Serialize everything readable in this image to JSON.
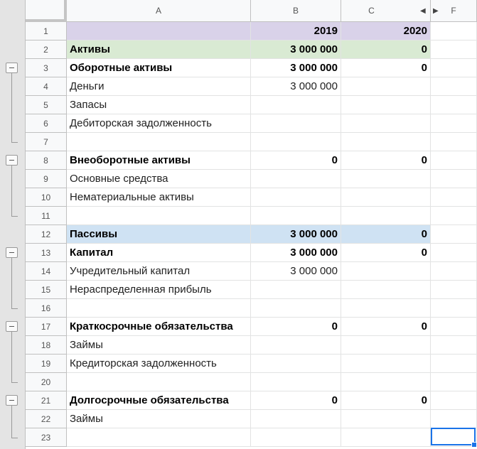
{
  "columns": {
    "A": "A",
    "B": "B",
    "C": "C",
    "F": "F"
  },
  "col_nav_icons": {
    "left": "triangle-left-icon",
    "right": "triangle-right-icon"
  },
  "colors": {
    "header_purple": "#d9d2e9",
    "assets_green": "#d9ead3",
    "liabilities_blue": "#cfe2f3",
    "selection_blue": "#1a73e8"
  },
  "rows": [
    {
      "n": "1",
      "a": "",
      "b": "2019",
      "c": "2020",
      "bold": true,
      "bg": "purple"
    },
    {
      "n": "2",
      "a": "Активы",
      "b": "3 000 000",
      "c": "0",
      "bold": true,
      "bg": "green"
    },
    {
      "n": "3",
      "a": "Оборотные активы",
      "b": "3 000 000",
      "c": "0",
      "bold": true,
      "bg": ""
    },
    {
      "n": "4",
      "a": "Деньги",
      "b": "3 000 000",
      "c": "",
      "bold": false,
      "bg": ""
    },
    {
      "n": "5",
      "a": "Запасы",
      "b": "",
      "c": "",
      "bold": false,
      "bg": ""
    },
    {
      "n": "6",
      "a": "Дебиторская задолженность",
      "b": "",
      "c": "",
      "bold": false,
      "bg": ""
    },
    {
      "n": "7",
      "a": "",
      "b": "",
      "c": "",
      "bold": false,
      "bg": ""
    },
    {
      "n": "8",
      "a": "Внеоборотные активы",
      "b": "0",
      "c": "0",
      "bold": true,
      "bg": ""
    },
    {
      "n": "9",
      "a": "Основные средства",
      "b": "",
      "c": "",
      "bold": false,
      "bg": ""
    },
    {
      "n": "10",
      "a": "Нематериальные активы",
      "b": "",
      "c": "",
      "bold": false,
      "bg": ""
    },
    {
      "n": "11",
      "a": "",
      "b": "",
      "c": "",
      "bold": false,
      "bg": ""
    },
    {
      "n": "12",
      "a": "Пассивы",
      "b": "3 000 000",
      "c": "0",
      "bold": true,
      "bg": "blue"
    },
    {
      "n": "13",
      "a": "Капитал",
      "b": "3 000 000",
      "c": "0",
      "bold": true,
      "bg": ""
    },
    {
      "n": "14",
      "a": "Учредительный капитал",
      "b": "3 000 000",
      "c": "",
      "bold": false,
      "bg": ""
    },
    {
      "n": "15",
      "a": "Нераспределенная прибыль",
      "b": "",
      "c": "",
      "bold": false,
      "bg": ""
    },
    {
      "n": "16",
      "a": "",
      "b": "",
      "c": "",
      "bold": false,
      "bg": ""
    },
    {
      "n": "17",
      "a": "Краткосрочные обязательства",
      "b": "0",
      "c": "0",
      "bold": true,
      "bg": ""
    },
    {
      "n": "18",
      "a": "Займы",
      "b": "",
      "c": "",
      "bold": false,
      "bg": ""
    },
    {
      "n": "19",
      "a": "Кредиторская задолженность",
      "b": "",
      "c": "",
      "bold": false,
      "bg": ""
    },
    {
      "n": "20",
      "a": "",
      "b": "",
      "c": "",
      "bold": false,
      "bg": ""
    },
    {
      "n": "21",
      "a": "Долгосрочные обязательства",
      "b": "0",
      "c": "0",
      "bold": true,
      "bg": ""
    },
    {
      "n": "22",
      "a": "Займы",
      "b": "",
      "c": "",
      "bold": false,
      "bg": ""
    },
    {
      "n": "23",
      "a": "",
      "b": "",
      "c": "",
      "bold": false,
      "bg": ""
    }
  ],
  "row_groups": [
    {
      "toggle_row": "3",
      "icon": "collapse-minus-icon"
    },
    {
      "toggle_row": "8",
      "icon": "collapse-minus-icon"
    },
    {
      "toggle_row": "13",
      "icon": "collapse-minus-icon"
    },
    {
      "toggle_row": "17",
      "icon": "collapse-minus-icon"
    },
    {
      "toggle_row": "21",
      "icon": "collapse-minus-icon"
    }
  ],
  "selected_cell": "F23"
}
